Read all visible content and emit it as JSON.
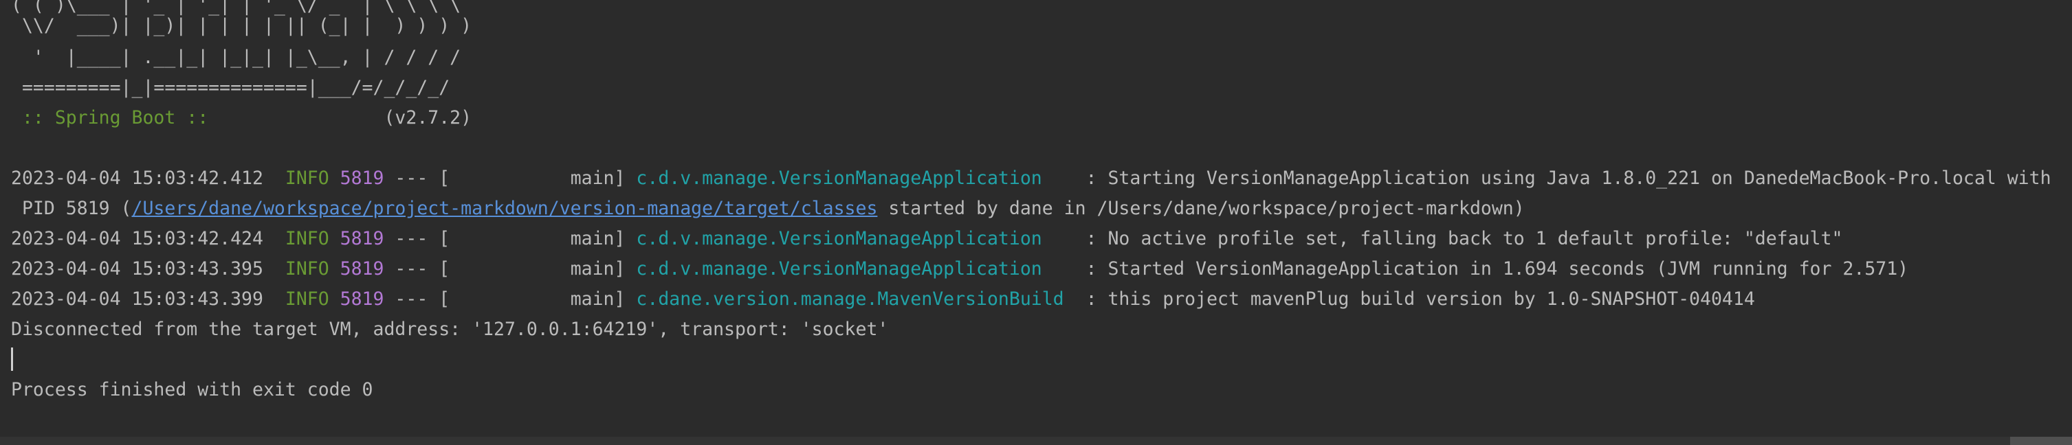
{
  "banner": {
    "lines": [
      "( ( )\\___ | '_ | '_| | '_ \\/ _` | \\ \\ \\ \\",
      " \\\\/  ___)| |_)| | | | | || (_| |  ) ) ) )",
      "  '  |____| .__|_| |_|_| |_\\__, | / / / /",
      " =========|_|==============|___/=/_/_/_/"
    ],
    "spring_label": " :: Spring Boot :: ",
    "version": "               (v2.7.2)"
  },
  "log": [
    {
      "timestamp": "2023-04-04 15:03:42.412",
      "level": "  INFO",
      "pid": " 5819",
      "thread": " --- [           main] ",
      "logger": "c.d.v.manage.VersionManageApplication",
      "message": "    : Starting VersionManageApplication using Java 1.8.0_221 on DanedeMacBook-Pro.local with",
      "continuation": {
        "prefix": " PID 5819 (",
        "link": "/Users/dane/workspace/project-markdown/version-manage/target/classes",
        "suffix": " started by dane in /Users/dane/workspace/project-markdown)"
      }
    },
    {
      "timestamp": "2023-04-04 15:03:42.424",
      "level": "  INFO",
      "pid": " 5819",
      "thread": " --- [           main] ",
      "logger": "c.d.v.manage.VersionManageApplication",
      "message": "    : No active profile set, falling back to 1 default profile: \"default\""
    },
    {
      "timestamp": "2023-04-04 15:03:43.395",
      "level": "  INFO",
      "pid": " 5819",
      "thread": " --- [           main] ",
      "logger": "c.d.v.manage.VersionManageApplication",
      "message": "    : Started VersionManageApplication in 1.694 seconds (JVM running for 2.571)"
    },
    {
      "timestamp": "2023-04-04 15:03:43.399",
      "level": "  INFO",
      "pid": " 5819",
      "thread": " --- [           main] ",
      "logger": "c.dane.version.manage.MavenVersionBuild",
      "message": "  : this project mavenPlug build version by 1.0-SNAPSHOT-040414"
    }
  ],
  "disconnect": "Disconnected from the target VM, address: '127.0.0.1:64219', transport: 'socket'",
  "exit": "Process finished with exit code 0",
  "colors": {
    "background": "#2b2b2b",
    "text": "#bbbbbb",
    "info": "#6a9b34",
    "pid": "#b379d5",
    "logger": "#21a3a8",
    "link": "#5890d9"
  }
}
